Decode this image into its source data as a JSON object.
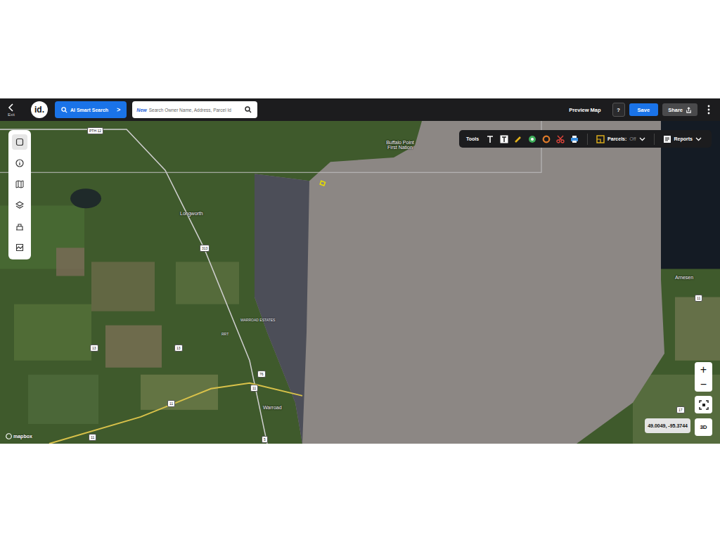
{
  "top_bar": {
    "exit": "Exit",
    "logo": "id.",
    "ai_search": {
      "label": "AI Smart Search",
      "chevron": ">"
    },
    "search": {
      "badge": "New",
      "placeholder": "Search Owner Name, Address, Parcel Id"
    },
    "actions": [
      {
        "label": "Preview Map",
        "kind": "link"
      },
      {
        "label": "?",
        "kind": "help"
      },
      {
        "label": "Save",
        "kind": "primary"
      },
      {
        "label": "Share",
        "kind": "secondary"
      }
    ]
  },
  "sidebar": {
    "items": [
      {
        "selected": true
      },
      {
        "selected": false
      },
      {
        "selected": false
      },
      {
        "selected": false
      },
      {
        "selected": false
      },
      {
        "selected": false
      }
    ]
  },
  "tools": {
    "label": "Tools",
    "parcels_label": "Parcels:",
    "parcels_value": "Off",
    "reports": "Reports"
  },
  "map": {
    "labels": [
      {
        "text": "PTH 12",
        "kind": "shield"
      },
      {
        "text": "Buffalo Point First Nation",
        "kind": "place"
      },
      {
        "text": "Longworth",
        "kind": "place"
      },
      {
        "text": "313",
        "kind": "shield"
      },
      {
        "text": "WARROAD ESTATES",
        "kind": "small"
      },
      {
        "text": "RRT",
        "kind": "small"
      },
      {
        "text": "13",
        "kind": "shield"
      },
      {
        "text": "13",
        "kind": "shield"
      },
      {
        "text": "11",
        "kind": "shield"
      },
      {
        "text": "11",
        "kind": "shield"
      },
      {
        "text": "11",
        "kind": "shield"
      },
      {
        "text": "76",
        "kind": "shield"
      },
      {
        "text": "Warroad",
        "kind": "place"
      },
      {
        "text": "5",
        "kind": "shield"
      },
      {
        "text": "Arnesen",
        "kind": "place"
      },
      {
        "text": "11",
        "kind": "shield"
      },
      {
        "text": "17",
        "kind": "shield"
      }
    ],
    "attribution": "mapbox",
    "coordinates": "49.0049, -95.3744",
    "zoom_in": "+",
    "zoom_out": "−",
    "three_d": "3D"
  }
}
